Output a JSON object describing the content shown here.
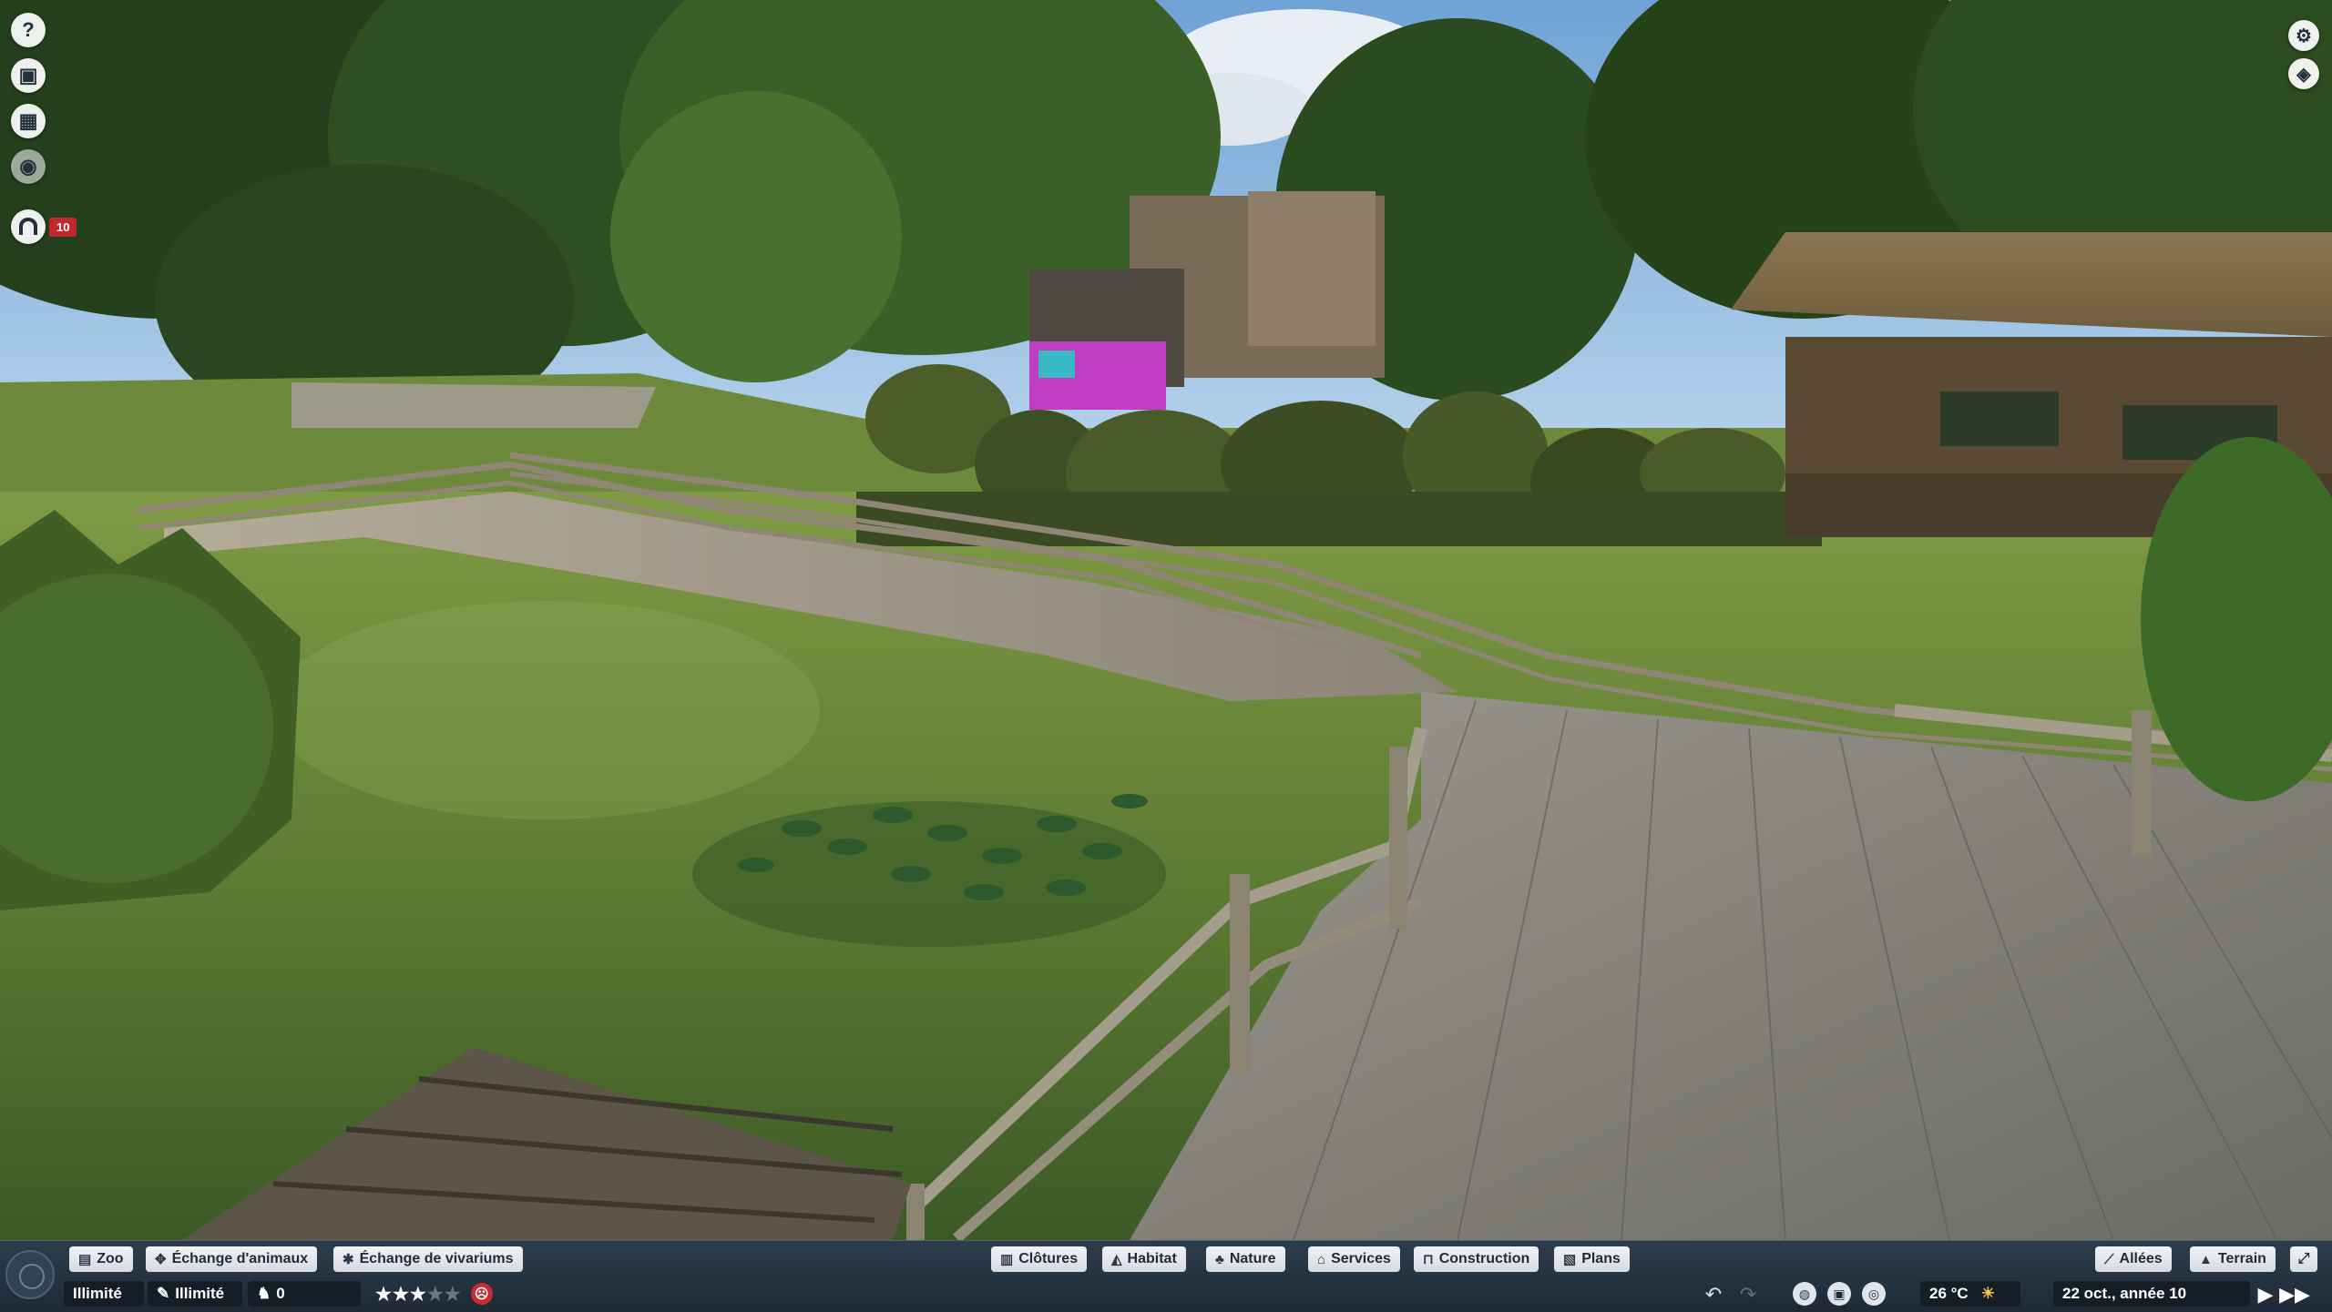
{
  "left_icons": [
    {
      "name": "help-icon",
      "glyph": "?"
    },
    {
      "name": "zoo-info-icon",
      "glyph": "▣"
    },
    {
      "name": "calendar-icon",
      "glyph": "▦"
    },
    {
      "name": "view-icon",
      "glyph": "◉"
    }
  ],
  "guests": {
    "count": "10",
    "icon": "gate-icon"
  },
  "right_icons": [
    {
      "name": "settings-icon",
      "glyph": "⚙"
    },
    {
      "name": "camera-icon",
      "glyph": "◈"
    }
  ],
  "toolbar": {
    "left_tabs": [
      {
        "label": "Zoo",
        "icon": "book-icon"
      },
      {
        "label": "Échange d'animaux",
        "icon": "paw-icon"
      },
      {
        "label": "Échange de vivariums",
        "icon": "bug-icon"
      }
    ],
    "center_tabs": [
      {
        "label": "Clôtures",
        "icon": "fence-icon"
      },
      {
        "label": "Habitat",
        "icon": "habitat-icon"
      },
      {
        "label": "Nature",
        "icon": "tree-icon"
      },
      {
        "label": "Services",
        "icon": "shop-icon"
      },
      {
        "label": "Construction",
        "icon": "construction-icon"
      },
      {
        "label": "Plans",
        "icon": "blueprint-icon"
      }
    ],
    "right_tabs": [
      {
        "label": "Allées",
        "icon": "path-icon"
      },
      {
        "label": "Terrain",
        "icon": "terrain-icon"
      }
    ],
    "stats": {
      "money": "Illimité",
      "research": "Illimité",
      "animals": "0",
      "rating_stars": 3,
      "rating_total": 5,
      "temperature": "26 °C",
      "date": "22 oct., année 10"
    }
  }
}
